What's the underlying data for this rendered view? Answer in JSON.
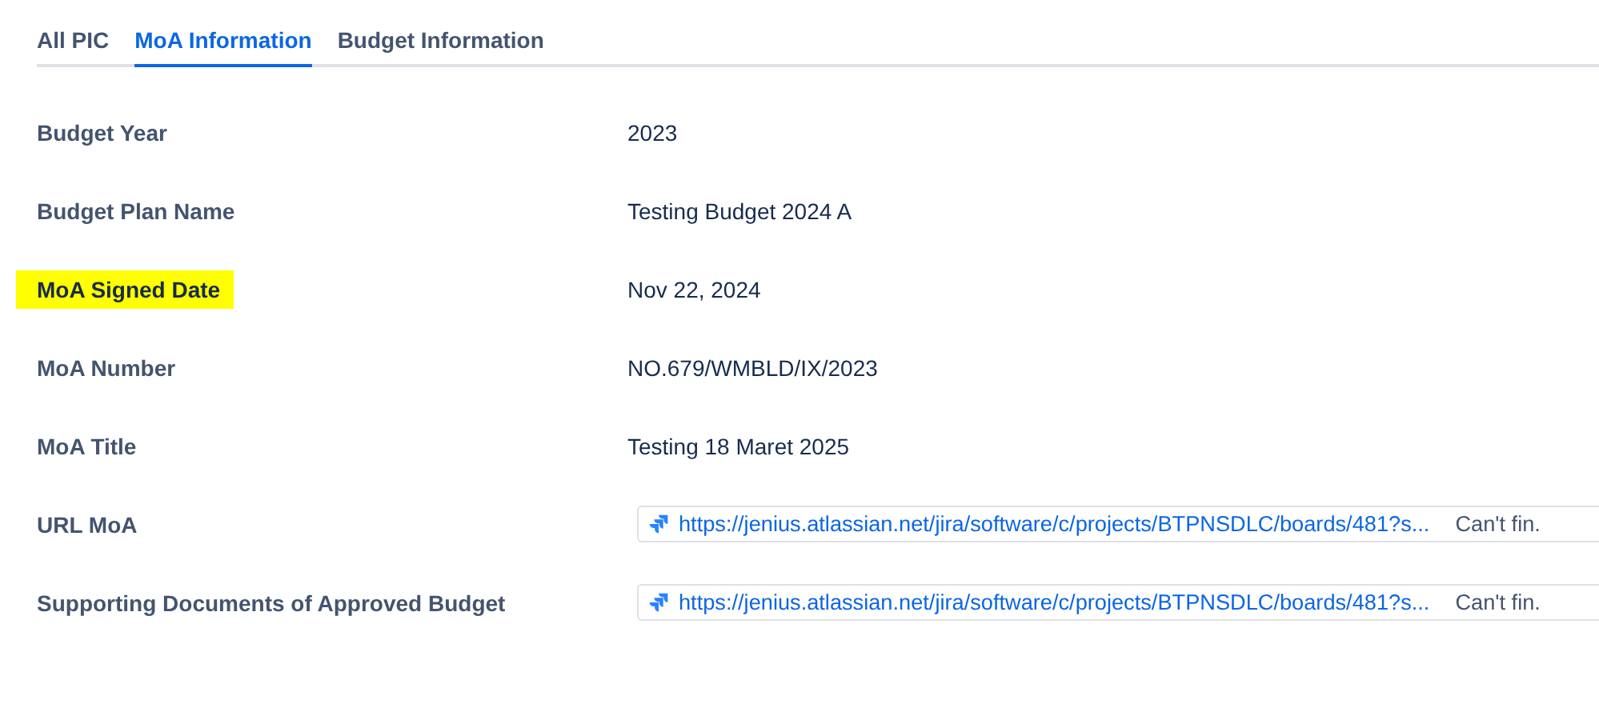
{
  "tabs": [
    {
      "label": "All PIC",
      "selected": false
    },
    {
      "label": "MoA Information",
      "selected": true
    },
    {
      "label": "Budget Information",
      "selected": false
    }
  ],
  "fields": [
    {
      "label": "Budget Year",
      "kind": "text",
      "value": "2023",
      "highlighted": false
    },
    {
      "label": "Budget Plan Name",
      "kind": "text",
      "value": "Testing Budget 2024 A",
      "highlighted": false
    },
    {
      "label": "MoA Signed Date",
      "kind": "text",
      "value": "Nov 22, 2024",
      "highlighted": true
    },
    {
      "label": "MoA Number",
      "kind": "text",
      "value": "NO.679/WMBLD/IX/2023",
      "highlighted": false
    },
    {
      "label": "MoA Title",
      "kind": "text",
      "value": "Testing 18 Maret 2025",
      "highlighted": false
    },
    {
      "label": "URL MoA",
      "kind": "link",
      "value": "https://jenius.atlassian.net/jira/software/c/projects/BTPNSDLC/boards/481?s...",
      "note": "Can't fin.",
      "highlighted": false
    },
    {
      "label": "Supporting Documents of Approved Budget",
      "kind": "link",
      "value": "https://jenius.atlassian.net/jira/software/c/projects/BTPNSDLC/boards/481?s...",
      "note": "Can't fin.",
      "highlighted": false
    }
  ]
}
